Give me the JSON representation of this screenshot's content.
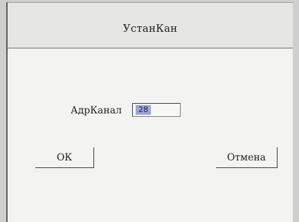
{
  "dialog": {
    "title": "УстанКан",
    "field": {
      "label": "АдрКанал",
      "value": "28"
    },
    "ok_label": "ОК",
    "cancel_label": "Отмена"
  }
}
